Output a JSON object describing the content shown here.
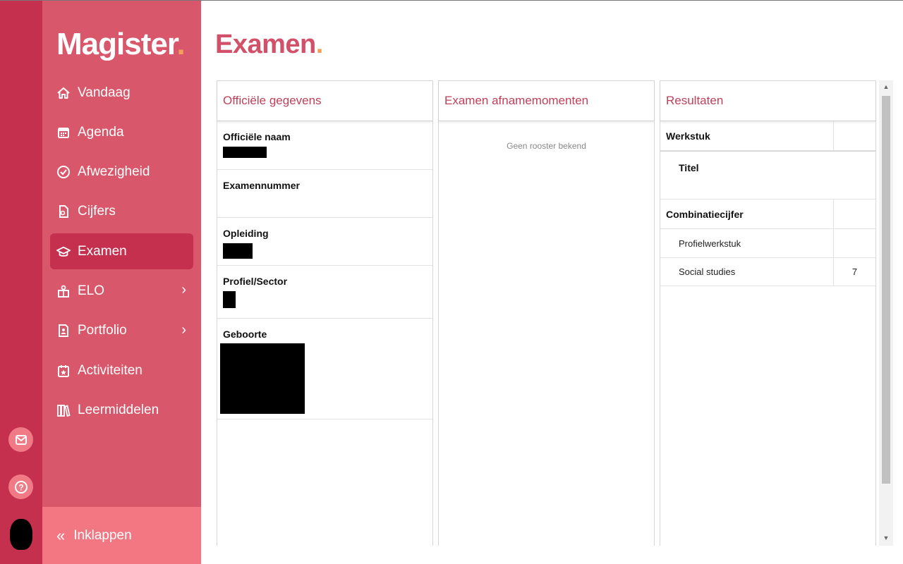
{
  "app": {
    "logo": "Magister",
    "logo_dot": "."
  },
  "page": {
    "title": "Examen",
    "title_dot": "."
  },
  "sidebar": {
    "items": [
      {
        "label": "Vandaag",
        "icon": "home-icon"
      },
      {
        "label": "Agenda",
        "icon": "calendar-icon"
      },
      {
        "label": "Afwezigheid",
        "icon": "check-circle-icon"
      },
      {
        "label": "Cijfers",
        "icon": "grades-icon"
      },
      {
        "label": "Examen",
        "icon": "graduation-cap-icon",
        "active": true
      },
      {
        "label": "ELO",
        "icon": "elo-icon",
        "has_submenu": true
      },
      {
        "label": "Portfolio",
        "icon": "portfolio-icon",
        "has_submenu": true
      },
      {
        "label": "Activiteiten",
        "icon": "activity-icon"
      },
      {
        "label": "Leermiddelen",
        "icon": "books-icon"
      }
    ],
    "collapse_label": "Inklappen"
  },
  "rail": {
    "icons": [
      "mail-icon",
      "help-icon",
      "avatar"
    ]
  },
  "panels": {
    "official": {
      "title": "Officiële gegevens",
      "fields": [
        {
          "label": "Officiële naam"
        },
        {
          "label": "Examennummer"
        },
        {
          "label": "Opleiding"
        },
        {
          "label": "Profiel/Sector"
        },
        {
          "label": "Geboorte"
        }
      ]
    },
    "moments": {
      "title": "Examen afnamemomenten",
      "empty_text": "Geen rooster bekend"
    },
    "results": {
      "title": "Resultaten",
      "rows": [
        {
          "label": "Werkstuk",
          "value": "",
          "type": "head"
        },
        {
          "label": "Titel",
          "value": "",
          "type": "titel"
        },
        {
          "label": "Combinatiecijfer",
          "value": "",
          "type": "head"
        },
        {
          "label": "Profielwerkstuk",
          "value": "",
          "type": "sub"
        },
        {
          "label": "Social studies",
          "value": "7",
          "type": "sub"
        }
      ]
    }
  },
  "colors": {
    "rail": "#c5304f",
    "sidebar": "#d9576a",
    "active": "#c5304f",
    "accent_dot": "#f5a05a",
    "title": "#d2506a"
  }
}
